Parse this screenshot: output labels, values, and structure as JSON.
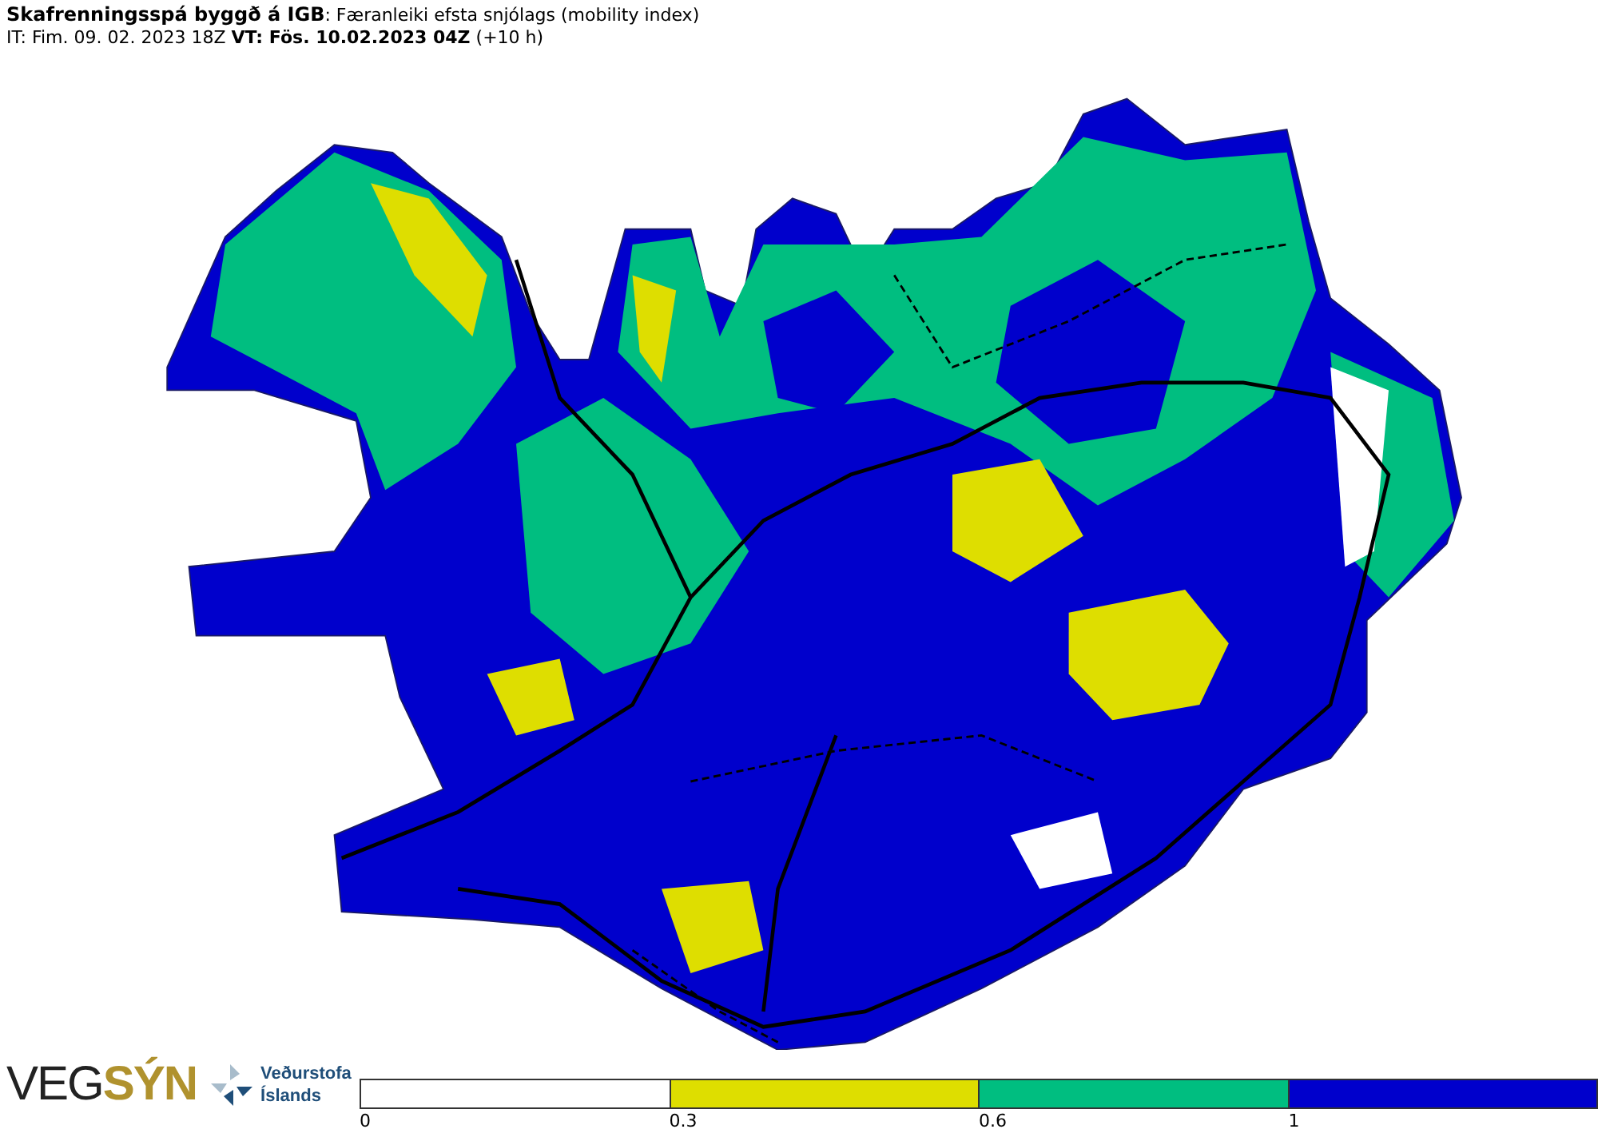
{
  "header": {
    "title": "**Skafrenningsspá byggð á IGB**: Færanleiki efsta snjólags (mobility index)",
    "times": "IT: Fim. 09. 02. 2023 18Z **VT: Fös. 10.02.2023 04Z** (+10 h)"
  },
  "logos": {
    "vegsyn_dark": "VEG",
    "vegsyn_gold": "SÝN",
    "agency_line1": "Veðurstofa",
    "agency_line2": "Íslands"
  },
  "legend": {
    "bins": [
      {
        "color": "#ffffff",
        "label": "0"
      },
      {
        "color": "#dede00",
        "label": "0.3"
      },
      {
        "color": "#00be80",
        "label": "0.6"
      },
      {
        "color": "#0000cc",
        "label": "1"
      }
    ]
  }
}
